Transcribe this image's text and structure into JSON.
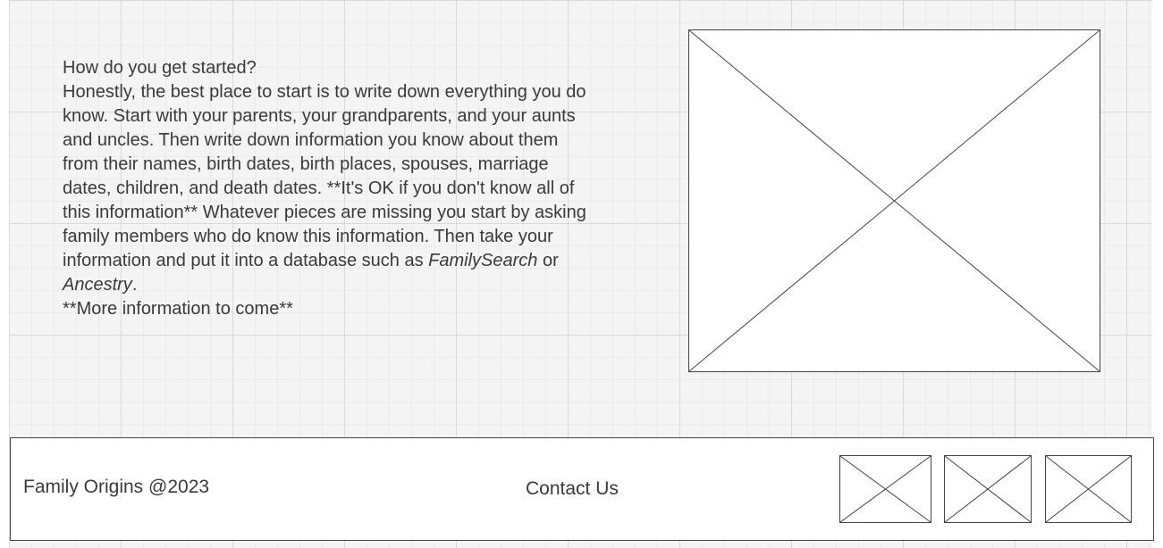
{
  "intro": {
    "question": "How do you get started?",
    "body_part1": "Honestly, the best place to start is to write down everything you do know. Start with your parents, your grandparents, and your aunts and uncles. Then write down information you know about them from their names, birth dates, birth places, spouses, marriage dates, children, and death dates. **It's OK if you don't know all of this information** Whatever pieces are missing you start by asking family members who do know this information. Then take your information and put it into a database such as ",
    "familysearch": "FamilySearch",
    "connector": " or ",
    "ancestry": "Ancestry",
    "period": ".",
    "more": "**More information to come**"
  },
  "footer": {
    "copyright": "Family Origins @2023",
    "contact": "Contact Us"
  }
}
